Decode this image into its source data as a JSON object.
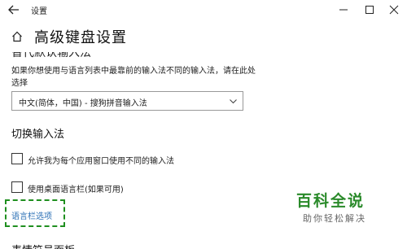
{
  "window": {
    "app_title": "设置"
  },
  "header": {
    "page_title": "高级键盘设置"
  },
  "default_input": {
    "heading_partial": "替代默认输入法",
    "description": "如果你想使用与语言列表中最靠前的输入法不同的输入法，请在此处选择",
    "selected_value": "中文(简体，中国) - 搜狗拼音输入法"
  },
  "switch_input": {
    "heading": "切换输入法",
    "options": [
      {
        "label": "允许我为每个应用窗口使用不同的输入法",
        "checked": false
      },
      {
        "label": "使用桌面语言栏(如果可用)",
        "checked": false
      }
    ],
    "language_bar_link": "语言栏选项"
  },
  "emoji_panel": {
    "heading_partial": "表情符号面板"
  },
  "watermark": {
    "main": "百科全说",
    "sub": "助你轻松解决"
  },
  "colors": {
    "link": "#2a6fb5",
    "focus_outline": "#1f8f1f",
    "watermark_green": "#2a8a2a"
  }
}
